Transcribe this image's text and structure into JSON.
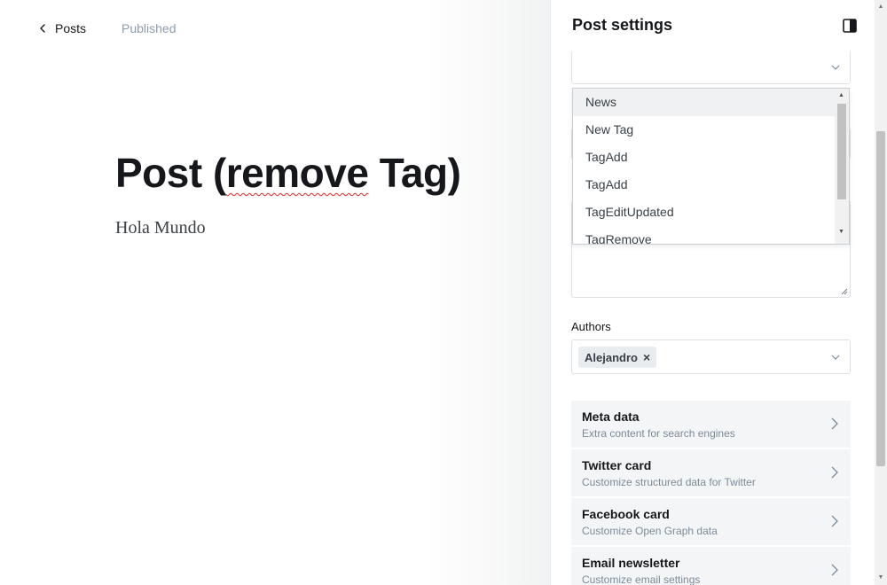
{
  "editor": {
    "back_label": "Posts",
    "status": "Published",
    "title_before": "Post (",
    "title_squiggle": "remove",
    "title_after": " Tag)",
    "body": "Hola Mundo"
  },
  "settings": {
    "title": "Post settings",
    "tags_dropdown": {
      "options": [
        "News",
        "New Tag",
        "TagAdd",
        "TagAdd",
        "TagEditUpdated",
        "TagRemove"
      ],
      "highlighted": "News"
    },
    "authors": {
      "label": "Authors",
      "selected": "Alejandro",
      "remove_glyph": "×"
    },
    "sections": [
      {
        "title": "Meta data",
        "subtitle": "Extra content for search engines"
      },
      {
        "title": "Twitter card",
        "subtitle": "Customize structured data for Twitter"
      },
      {
        "title": "Facebook card",
        "subtitle": "Customize Open Graph data"
      },
      {
        "title": "Email newsletter",
        "subtitle": "Customize email settings"
      }
    ]
  },
  "colors": {
    "accent_text": "#15171a",
    "muted": "#8e9cac",
    "spellcheck": "#e0242c",
    "section_bg": "#f4f5f6"
  },
  "icons": {
    "back": "chevron-left-icon",
    "panel_toggle": "sidebar-toggle-icon",
    "dropdown": "chevron-down-icon",
    "section": "chevron-right-icon",
    "remove": "close-icon"
  }
}
